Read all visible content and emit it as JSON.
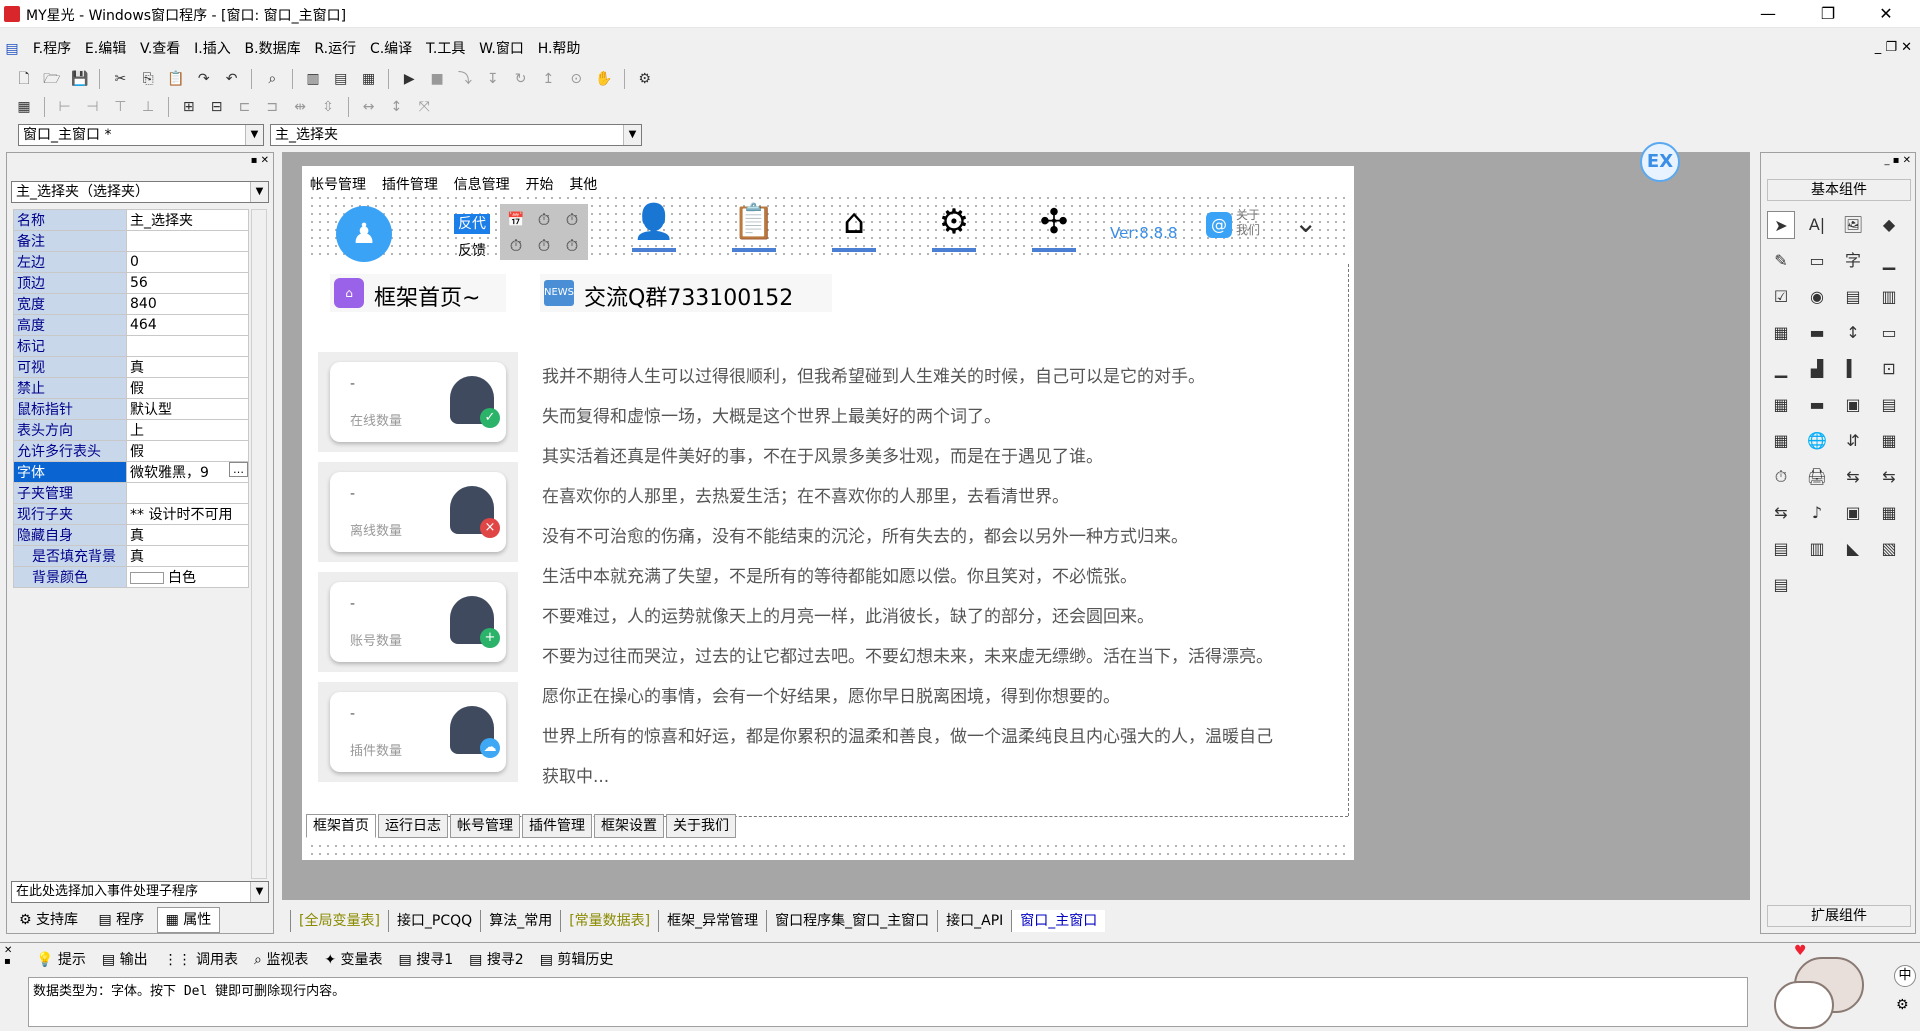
{
  "window": {
    "title": "MY星光 - Windows窗口程序 - [窗口: 窗口_主窗口]"
  },
  "menu": [
    "F.程序",
    "E.编辑",
    "V.查看",
    "I.插入",
    "B.数据库",
    "R.运行",
    "C.编译",
    "T.工具",
    "W.窗口",
    "H.帮助"
  ],
  "combos": {
    "window_select": "窗口_主窗口 *",
    "control_select": "主_选择夹"
  },
  "props": {
    "header": "主_选择夹（选择夹）",
    "rows": [
      {
        "n": "名称",
        "v": "主_选择夹"
      },
      {
        "n": "备注",
        "v": ""
      },
      {
        "n": "左边",
        "v": "0"
      },
      {
        "n": "顶边",
        "v": "56"
      },
      {
        "n": "宽度",
        "v": "840"
      },
      {
        "n": "高度",
        "v": "464"
      },
      {
        "n": "标记",
        "v": ""
      },
      {
        "n": "可视",
        "v": "真"
      },
      {
        "n": "禁止",
        "v": "假"
      },
      {
        "n": "鼠标指针",
        "v": "默认型"
      },
      {
        "n": "表头方向",
        "v": "上"
      },
      {
        "n": "允许多行表头",
        "v": "假"
      },
      {
        "n": "字体",
        "v": "微软雅黑，9"
      },
      {
        "n": "子夹管理",
        "v": ""
      },
      {
        "n": "现行子夹",
        "v": "** 设计时不可用"
      },
      {
        "n": "隐藏自身",
        "v": "真"
      },
      {
        "n": "是否填充背景",
        "v": "真"
      },
      {
        "n": "背景颜色",
        "v": "白色"
      }
    ],
    "event_combo": "在此处选择加入事件处理子程序",
    "tabs": [
      "支持库",
      "程序",
      "属性"
    ]
  },
  "form": {
    "nav": [
      "帐号管理",
      "插件管理",
      "信息管理",
      "开始",
      "其他"
    ],
    "fandai": "反代",
    "fankui": "反馈",
    "version": "Ver:8.8.8",
    "about_top": "关于",
    "about_bot": "我们",
    "home_title": "框架首页~",
    "qq_group": "交流Q群733100152",
    "stats": [
      {
        "v": "-",
        "l": "在线数量",
        "c": "#2bb36a",
        "g": "✓"
      },
      {
        "v": "-",
        "l": "离线数量",
        "c": "#e04646",
        "g": "×"
      },
      {
        "v": "-",
        "l": "账号数量",
        "c": "#2bb36a",
        "g": "+"
      },
      {
        "v": "-",
        "l": "插件数量",
        "c": "#3fa8f4",
        "g": "☁"
      }
    ],
    "quotes": [
      "我并不期待人生可以过得很顺利，但我希望碰到人生难关的时候，自己可以是它的对手。",
      "失而复得和虚惊一场，大概是这个世界上最美好的两个词了。",
      "其实活着还真是件美好的事，不在于风景多美多壮观，而是在于遇见了谁。",
      "在喜欢你的人那里，去热爱生活；在不喜欢你的人那里，去看清世界。",
      "没有不可治愈的伤痛，没有不能结束的沉沦，所有失去的，都会以另外一种方式归来。",
      "生活中本就充满了失望，不是所有的等待都能如愿以偿。你且笑对，不必慌张。",
      "不要难过，人的运势就像天上的月亮一样，此消彼长，缺了的部分，还会圆回来。",
      "不要为过往而哭泣，过去的让它都过去吧。不要幻想未来，未来虚无缥缈。活在当下，活得漂亮。",
      "愿你正在操心的事情，会有一个好结果，愿你早日脱离困境，得到你想要的。",
      "世界上所有的惊喜和好运，都是你累积的温柔和善良，做一个温柔纯良且内心强大的人，温暖自己",
      "获取中..."
    ],
    "bottom_tabs": [
      "框架首页",
      "运行日志",
      "帐号管理",
      "插件管理",
      "框架设置",
      "关于我们"
    ]
  },
  "code_tabs": [
    "[全局变量表]",
    "接口_PCQQ",
    "算法_常用",
    "[常量数据表]",
    "框架_异常管理",
    "窗口程序集_窗口_主窗口",
    "接口_API",
    "窗口_主窗口"
  ],
  "right_panel": {
    "title": "基本组件",
    "footer": "扩展组件"
  },
  "output_tabs": [
    "提示",
    "输出",
    "调用表",
    "监视表",
    "变量表",
    "搜寻1",
    "搜寻2",
    "剪辑历史"
  ],
  "status_text": "数据类型为：字体。按下 Del 键即可删除现行内容。",
  "ex_badge": "EX",
  "ime": "中"
}
